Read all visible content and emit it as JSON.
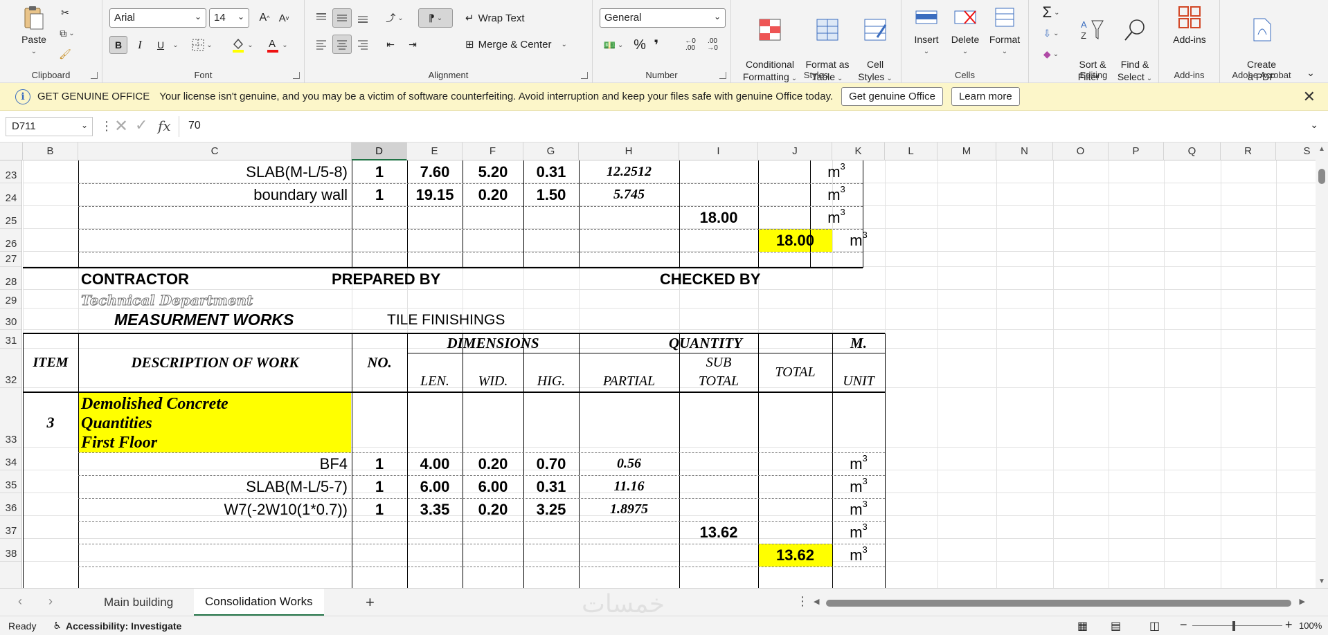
{
  "ribbon": {
    "clipboard": {
      "label": "Clipboard",
      "paste": "Paste"
    },
    "font": {
      "label": "Font",
      "name": "Arial",
      "size": "14",
      "bold": "B",
      "italic": "I",
      "underline": "U"
    },
    "alignment": {
      "label": "Alignment",
      "wrap_text": "Wrap Text",
      "merge_center": "Merge & Center"
    },
    "number": {
      "label": "Number",
      "format": "General",
      "percent": "%",
      "comma": "❜"
    },
    "styles": {
      "label": "Styles",
      "conditional": "Conditional\nFormatting",
      "format_table": "Format as\nTable",
      "cell_styles": "Cell\nStyles"
    },
    "cells": {
      "label": "Cells",
      "insert": "Insert",
      "delete": "Delete",
      "format": "Format"
    },
    "editing": {
      "label": "Editing",
      "sort_filter": "Sort &\nFilter",
      "find_select": "Find &\nSelect"
    },
    "addins": {
      "label": "Add-ins",
      "addins": "Add-ins"
    },
    "acrobat": {
      "label": "Adobe Acrobat",
      "create_pdf": "Create\na PDF"
    }
  },
  "banner": {
    "title": "GET GENUINE OFFICE",
    "message": "Your license isn't genuine, and you may be a victim of software counterfeiting. Avoid interruption and keep your files safe with genuine Office today.",
    "btn_genuine": "Get genuine Office",
    "btn_learn": "Learn more",
    "close": "✕"
  },
  "formula_bar": {
    "name_box": "D711",
    "value": "70",
    "fx": "fx"
  },
  "columns": [
    "B",
    "C",
    "D",
    "E",
    "F",
    "G",
    "H",
    "I",
    "J",
    "K",
    "L",
    "M",
    "N",
    "O",
    "P",
    "Q",
    "R",
    "S"
  ],
  "selected_column": "D",
  "rows": [
    "23",
    "24",
    "25",
    "26",
    "27",
    "28",
    "29",
    "30",
    "31",
    "32",
    "33",
    "34",
    "35",
    "36",
    "37",
    "38"
  ],
  "sheet": {
    "r23": {
      "desc": "SLAB(M-L/5-8)",
      "no": "1",
      "len": "7.60",
      "wid": "5.20",
      "hig": "0.31",
      "partial": "12.2512",
      "unit": "m"
    },
    "r24": {
      "desc": "boundary wall",
      "no": "1",
      "len": "19.15",
      "wid": "0.20",
      "hig": "1.50",
      "partial": "5.745",
      "unit": "m"
    },
    "r25": {
      "subtotal": "18.00",
      "unit": "m"
    },
    "r26": {
      "total": "18.00",
      "unit": "m"
    },
    "r28": {
      "contractor": "CONTRACTOR",
      "prepared": "PREPARED BY",
      "checked": "CHECKED BY"
    },
    "r29": {
      "dept": "Technical Department"
    },
    "r30": {
      "title": "MEASURMENT WORKS",
      "subtitle": "TILE FINISHINGS"
    },
    "header": {
      "item": "ITEM",
      "description": "DESCRIPTION OF WORK",
      "no": "NO.",
      "dimensions": "DIMENSIONS",
      "quantity": "QUANTITY",
      "m": "M.",
      "len": "LEN.",
      "wid": "WID.",
      "hig": "HIG.",
      "partial": "PARTIAL",
      "sub": "SUB",
      "total_sub": "TOTAL",
      "total": "TOTAL",
      "unit": "UNIT"
    },
    "r33": {
      "item": "3",
      "line1": "Demolished Concrete",
      "line2": "Quantities",
      "line3": "First Floor"
    },
    "r34": {
      "desc": "BF4",
      "no": "1",
      "len": "4.00",
      "wid": "0.20",
      "hig": "0.70",
      "partial": "0.56",
      "unit": "m"
    },
    "r35": {
      "desc": "SLAB(M-L/5-7)",
      "no": "1",
      "len": "6.00",
      "wid": "6.00",
      "hig": "0.31",
      "partial": "11.16",
      "unit": "m"
    },
    "r36": {
      "desc": "W7(-2W10(1*0.7))",
      "no": "1",
      "len": "3.35",
      "wid": "0.20",
      "hig": "3.25",
      "partial": "1.8975",
      "unit": "m"
    },
    "r37": {
      "subtotal": "13.62",
      "unit": "m"
    },
    "r38": {
      "total": "13.62",
      "unit": "m"
    },
    "unit_exp": "3"
  },
  "tabs": {
    "sheet1": "Main building",
    "sheet2": "Consolidation Works",
    "add": "+"
  },
  "watermark": "خمسات",
  "status": {
    "ready": "Ready",
    "accessibility": "Accessibility: Investigate",
    "zoom": "100%"
  },
  "colors": {
    "accent": "#217346",
    "highlight": "#ffff00",
    "banner": "#fcf6c9"
  }
}
